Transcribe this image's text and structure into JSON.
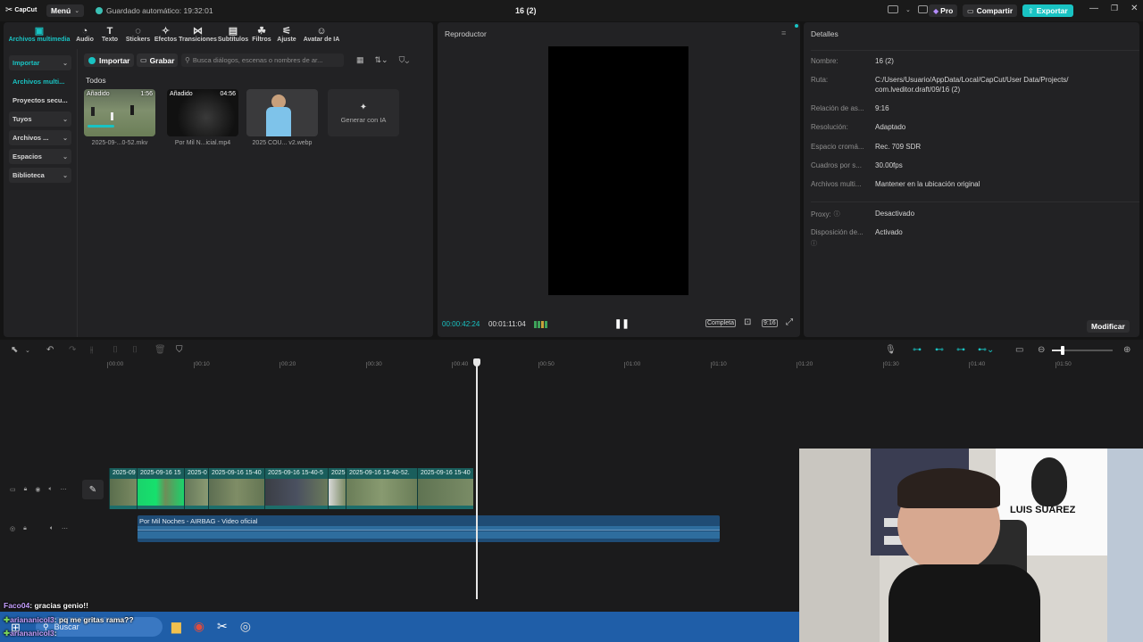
{
  "app": {
    "logo": "CapCut",
    "menu": "Menú",
    "autosave": "Guardado automático: 19:32:01",
    "project_title": "16 (2)",
    "pro": "Pro",
    "share": "Compartir",
    "export": "Exportar"
  },
  "toolbar": [
    {
      "label": "Archivos multimedia",
      "icon": "media-icon"
    },
    {
      "label": "Audio",
      "icon": "audio-icon"
    },
    {
      "label": "Texto",
      "icon": "text-icon"
    },
    {
      "label": "Stickers",
      "icon": "sticker-icon"
    },
    {
      "label": "Efectos",
      "icon": "effects-icon"
    },
    {
      "label": "Transiciones",
      "icon": "transitions-icon"
    },
    {
      "label": "Subtítulos",
      "icon": "subtitles-icon"
    },
    {
      "label": "Filtros",
      "icon": "filters-icon"
    },
    {
      "label": "Ajuste",
      "icon": "adjust-icon"
    },
    {
      "label": "Avatar de IA",
      "icon": "avatar-icon"
    }
  ],
  "sidebar": {
    "items": [
      {
        "label": "Importar",
        "chevron": true,
        "active": true
      },
      {
        "label": "Archivos multi...",
        "chevron": false,
        "active": true
      },
      {
        "label": "Proyectos secu...",
        "chevron": false
      },
      {
        "label": "Tuyos",
        "chevron": true
      },
      {
        "label": "Archivos ...",
        "chevron": true
      },
      {
        "label": "Espacios",
        "chevron": true
      },
      {
        "label": "Biblioteca",
        "chevron": true
      }
    ]
  },
  "media": {
    "import_btn": "Importar",
    "record_btn": "Grabar",
    "search_placeholder": "Busca diálogos, escenas o nombres de ar...",
    "section": "Todos",
    "items": [
      {
        "name": "2025-09-...0-52.mkv",
        "badge": "Añadido",
        "duration": "1:56"
      },
      {
        "name": "Por Mil N...icial.mp4",
        "badge": "Añadido",
        "duration": "04:56"
      },
      {
        "name": "2025 COU... v2.webp",
        "badge": "",
        "duration": ""
      },
      {
        "name": "Generar con IA",
        "badge": "",
        "duration": ""
      }
    ]
  },
  "player": {
    "title": "Reproductor",
    "current": "00:00:42:24",
    "total": "00:01:11:04",
    "quality": "Completa",
    "ratio": "9:16"
  },
  "details": {
    "title": "Detalles",
    "rows": [
      {
        "label": "Nombre:",
        "value": "16 (2)"
      },
      {
        "label": "Ruta:",
        "value": "C:/Users/Usuario/AppData/Local/CapCut/User Data/Projects/",
        "value2": "com.lveditor.draft/09/16 (2)"
      },
      {
        "label": "Relación de as...",
        "value": "9:16"
      },
      {
        "label": "Resolución:",
        "value": "Adaptado"
      },
      {
        "label": "Espacio cromá...",
        "value": "Rec. 709 SDR"
      },
      {
        "label": "Cuadros por s...",
        "value": "30.00fps"
      },
      {
        "label": "Archivos multi...",
        "value": "Mantener en la ubicación original"
      },
      {
        "label": "Proxy:",
        "value": "Desactivado"
      },
      {
        "label": "Disposición de...",
        "value": "Activado"
      }
    ],
    "modify": "Modificar"
  },
  "timeline": {
    "ticks": [
      "00:00",
      "00:10",
      "00:20",
      "00:30",
      "00:40",
      "00:50",
      "01:00",
      "01:10",
      "01:20",
      "01:30",
      "01:40",
      "01:50"
    ],
    "clips": [
      "2025-09",
      "2025-09-16 15",
      "2025-0",
      "2025-09-16 15-40",
      "2025-09-16 15-40-5",
      "2025",
      "2025-09-16 15-40-52.",
      "2025-09-16 15-40"
    ],
    "audio": "Por Mil Noches - AIRBAG - Video oficial"
  },
  "chat": [
    {
      "user": "Faco04",
      "msg": ": gracias genio!!"
    },
    {
      "user": "ariananicol3",
      "msg": ": pq me gritas rama??"
    },
    {
      "user": "ariananicol3",
      "msg": ":"
    }
  ],
  "taskbar": {
    "search": "Buscar"
  },
  "webcam": {
    "shirt_text": "LUIS SUAREZ"
  }
}
